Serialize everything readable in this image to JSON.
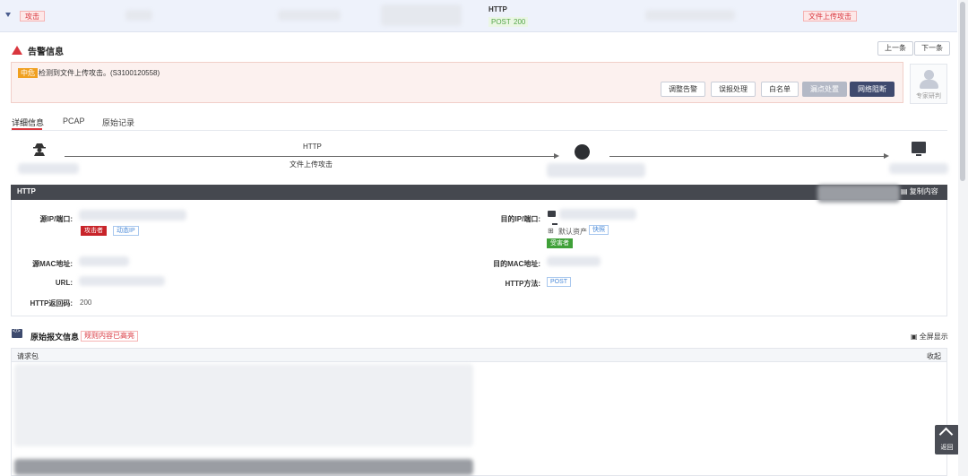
{
  "top_row": {
    "event_tag": "攻击",
    "protocol": "HTTP",
    "method": "POST",
    "status_code": "200",
    "attack_type_tag": "文件上传攻击"
  },
  "alarm": {
    "title": "告警信息",
    "prev_label": "上一条",
    "next_label": "下一条",
    "level": "中危",
    "description": "检测到文件上传攻击。(S3100120558)",
    "actions": [
      "调整告警",
      "误报处理",
      "白名单",
      "漏点处置",
      "网络阻断"
    ],
    "expert_label": "专家研判"
  },
  "tabs": [
    "详细信息",
    "PCAP",
    "原始记录"
  ],
  "flow": {
    "protocol": "HTTP",
    "attack_label": "文件上传攻击"
  },
  "http_panel": {
    "title": "HTTP",
    "copy_label": "复制内容",
    "src_ip_label": "源IP/端口:",
    "attacker_badge": "攻击者",
    "dynamic_ip_badge": "动态IP",
    "dst_ip_label": "目的IP/端口:",
    "default_asset": "默认资产",
    "snapshot_badge": "快照",
    "victim_badge": "受害者",
    "src_mac_label": "源MAC地址:",
    "dst_mac_label": "目的MAC地址:",
    "url_label": "URL:",
    "http_method_label": "HTTP方法:",
    "http_method_value": "POST",
    "http_code_label": "HTTP返回码:",
    "http_code_value": "200"
  },
  "raw": {
    "title": "原始报文信息",
    "rule_tag": "规则内容已高亮",
    "fullscreen_label": "全屏显示",
    "request_label": "请求包",
    "collapse_label": "收起"
  },
  "back_top_label": "返回"
}
